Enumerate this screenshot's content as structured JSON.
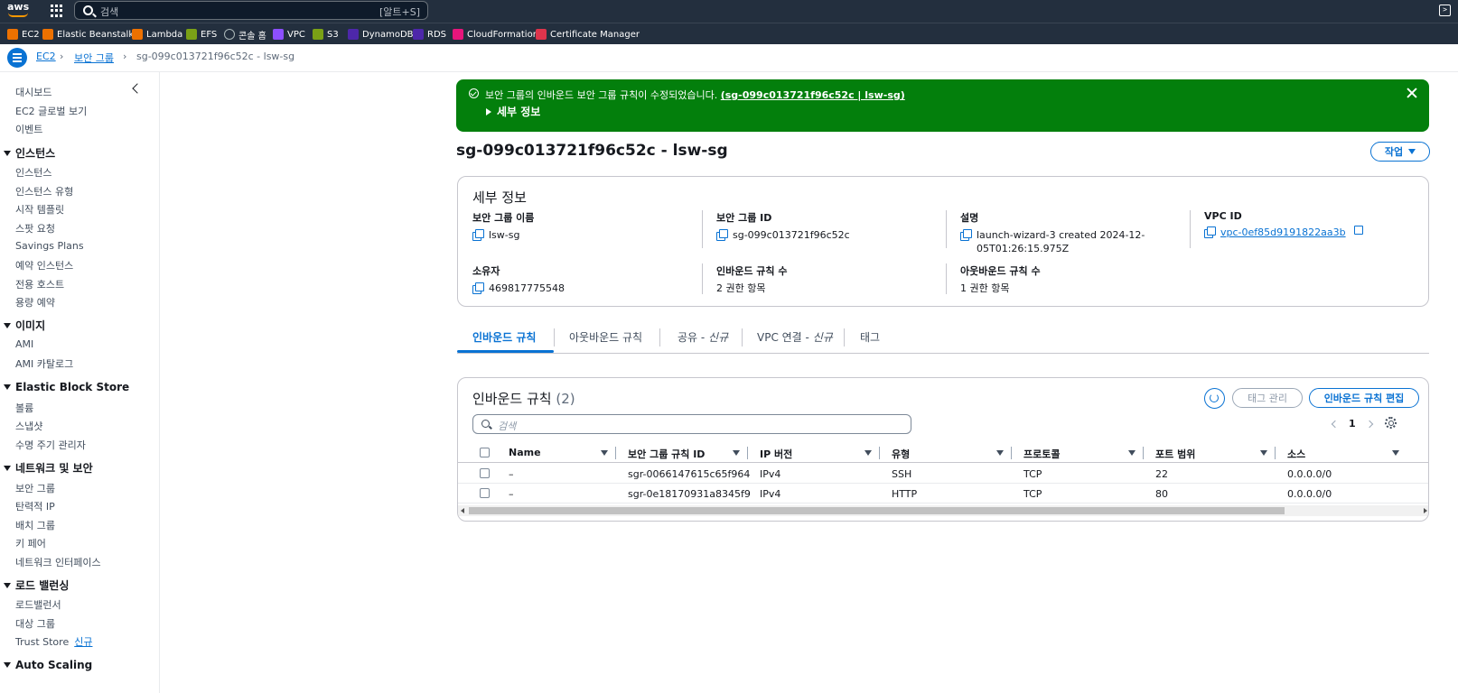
{
  "topnav": {
    "logo_text": "aws",
    "search_placeholder": "검색",
    "search_shortcut": "[알트+S]",
    "favorites": [
      {
        "label": "EC2",
        "icon": "ec2-icon",
        "color": "#ed7100"
      },
      {
        "label": "Elastic Beanstalk",
        "icon": "beanstalk-icon",
        "color": "#ed7100"
      },
      {
        "label": "Lambda",
        "icon": "lambda-icon",
        "color": "#ed7100"
      },
      {
        "label": "EFS",
        "icon": "efs-icon",
        "color": "#7aa116"
      },
      {
        "label": "콘솔 홈",
        "icon": "console-home-icon",
        "color": "#232f3e"
      },
      {
        "label": "VPC",
        "icon": "vpc-icon",
        "color": "#8c4fff"
      },
      {
        "label": "S3",
        "icon": "s3-icon",
        "color": "#7aa116"
      },
      {
        "label": "DynamoDB",
        "icon": "dynamodb-icon",
        "color": "#4d27aa"
      },
      {
        "label": "RDS",
        "icon": "rds-icon",
        "color": "#4d27aa"
      },
      {
        "label": "CloudFormation",
        "icon": "cloudformation-icon",
        "color": "#e7157b"
      },
      {
        "label": "Certificate Manager",
        "icon": "certificate-manager-icon",
        "color": "#dd344c"
      }
    ]
  },
  "breadcrumb": {
    "service": "EC2",
    "section": "보안 그룹",
    "current": "sg-099c013721f96c52c - lsw-sg"
  },
  "sidebar": {
    "top_items": [
      "대시보드",
      "EC2 글로벌 보기",
      "이벤트"
    ],
    "groups": [
      {
        "title": "인스턴스",
        "items": [
          "인스턴스",
          "인스턴스 유형",
          "시작 템플릿",
          "스팟 요청",
          "Savings Plans",
          "예약 인스턴스",
          "전용 호스트",
          "용량 예약"
        ]
      },
      {
        "title": "이미지",
        "items": [
          "AMI",
          "AMI 카탈로그"
        ]
      },
      {
        "title": "Elastic Block Store",
        "items": [
          "볼륨",
          "스냅샷",
          "수명 주기 관리자"
        ]
      },
      {
        "title": "네트워크 및 보안",
        "items": [
          "보안 그룹",
          "탄력적 IP",
          "배치 그룹",
          "키 페어",
          "네트워크 인터페이스"
        ]
      },
      {
        "title": "로드 밸런싱",
        "items": [
          "로드밸런서",
          "대상 그룹",
          "Trust Store"
        ]
      },
      {
        "title": "Auto Scaling",
        "items": []
      }
    ],
    "new_badge": "신규"
  },
  "flash": {
    "message": "보안 그룹의 인바운드 보안 그룹 규칙이 수정되었습니다.",
    "link": "(sg-099c013721f96c52c | lsw-sg)",
    "details_label": "세부 정보",
    "color": "#037f0c"
  },
  "page": {
    "title": "sg-099c013721f96c52c - lsw-sg",
    "actions_label": "작업"
  },
  "details": {
    "title": "세부 정보",
    "fields": {
      "name": {
        "label": "보안 그룹 이름",
        "value": "lsw-sg"
      },
      "id": {
        "label": "보안 그룹 ID",
        "value": "sg-099c013721f96c52c"
      },
      "description": {
        "label": "설명",
        "value": "launch-wizard-3 created 2024-12-05T01:26:15.975Z"
      },
      "vpc": {
        "label": "VPC ID",
        "value": "vpc-0ef85d9191822aa3b"
      },
      "owner": {
        "label": "소유자",
        "value": "469817775548"
      },
      "inbound_count": {
        "label": "인바운드 규칙 수",
        "value": "2 권한 항목"
      },
      "outbound_count": {
        "label": "아웃바운드 규칙 수",
        "value": "1 권한 항목"
      }
    }
  },
  "tabs": {
    "inbound": "인바운드 규칙",
    "outbound": "아웃바운드 규칙",
    "sharing": "공유 - ",
    "sharing_new": "신규",
    "vpc_assoc": "VPC 연결 - ",
    "vpc_assoc_new": "신규",
    "tags": "태그"
  },
  "rules": {
    "title": "인바운드 규칙",
    "count": "(2)",
    "manage_tags": "태그 관리",
    "edit_rules": "인바운드 규칙 편집",
    "search_placeholder": "검색",
    "page": "1",
    "columns": [
      "Name",
      "보안 그룹 규칙 ID",
      "IP 버전",
      "유형",
      "프로토콜",
      "포트 범위",
      "소스"
    ],
    "rows": [
      [
        "–",
        "sgr-0066147615c65f964",
        "IPv4",
        "SSH",
        "TCP",
        "22",
        "0.0.0.0/0"
      ],
      [
        "–",
        "sgr-0e18170931a8345f9",
        "IPv4",
        "HTTP",
        "TCP",
        "80",
        "0.0.0.0/0"
      ]
    ]
  }
}
